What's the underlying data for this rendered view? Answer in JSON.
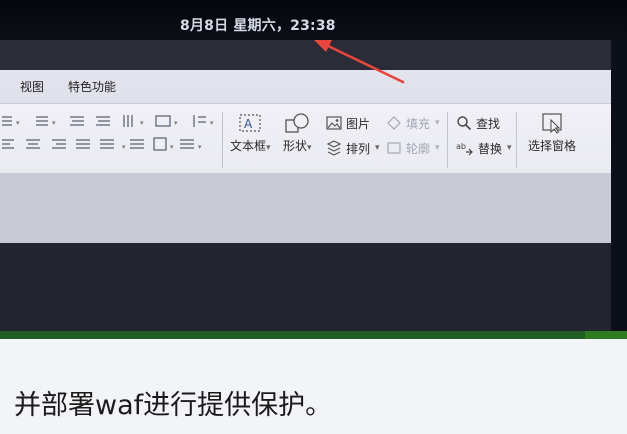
{
  "header": {
    "datetime": "8月8日 星期六，23:38"
  },
  "menubar": {
    "items": [
      {
        "label": "视图"
      },
      {
        "label": "特色功能"
      }
    ]
  },
  "ribbon": {
    "text_box": {
      "label": "文本框",
      "icon": "text-box-icon"
    },
    "shapes": {
      "label": "形状",
      "icon": "shapes-icon"
    },
    "picture": {
      "label": "图片",
      "icon": "picture-icon"
    },
    "arrange": {
      "label": "排列",
      "icon": "arrange-icon"
    },
    "fill": {
      "label": "填充",
      "icon": "fill-icon",
      "enabled": false
    },
    "outline": {
      "label": "轮廓",
      "icon": "outline-icon",
      "enabled": false
    },
    "find": {
      "label": "查找",
      "icon": "search-icon"
    },
    "replace": {
      "label": "替换",
      "icon": "replace-icon"
    },
    "selection_pane": {
      "label": "选择窗格",
      "icon": "selection-pane-icon"
    }
  },
  "subtitle": {
    "text": "并部署waf进行提供保护。"
  },
  "colors": {
    "annotation_arrow": "#e8453c",
    "green_strip": "#1f5e25"
  }
}
